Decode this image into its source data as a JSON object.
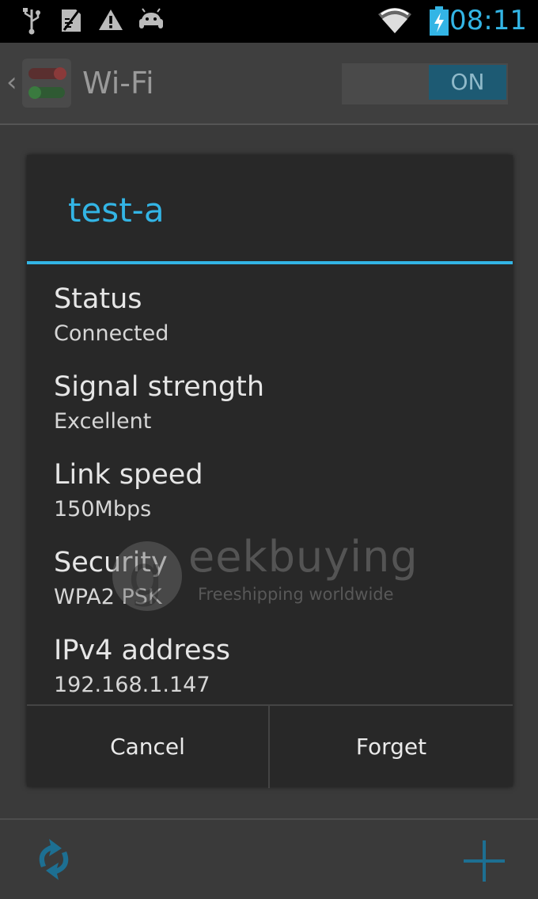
{
  "status_bar": {
    "time": "08:11",
    "icons": [
      "usb-icon",
      "no-sim-icon",
      "warning-icon",
      "android-icon",
      "wifi-icon",
      "battery-charging-icon"
    ]
  },
  "app_bar": {
    "title": "Wi-Fi",
    "toggle_label": "ON",
    "toggle_state": "on"
  },
  "dialog": {
    "title": "test-a",
    "fields": [
      {
        "label": "Status",
        "value": "Connected"
      },
      {
        "label": "Signal strength",
        "value": "Excellent"
      },
      {
        "label": "Link speed",
        "value": "150Mbps"
      },
      {
        "label": "Security",
        "value": "WPA2 PSK"
      },
      {
        "label": "IPv4 address",
        "value": "192.168.1.147"
      }
    ],
    "buttons": {
      "cancel": "Cancel",
      "forget": "Forget"
    }
  },
  "bottom_bar": {
    "icons": [
      "refresh-icon",
      "add-icon"
    ]
  },
  "watermark": {
    "brand": "eekbuying",
    "tagline": "Freeshipping worldwide"
  },
  "colors": {
    "accent": "#33b5e5",
    "dialog_bg": "#282828",
    "status_bar_bg": "#000000"
  }
}
